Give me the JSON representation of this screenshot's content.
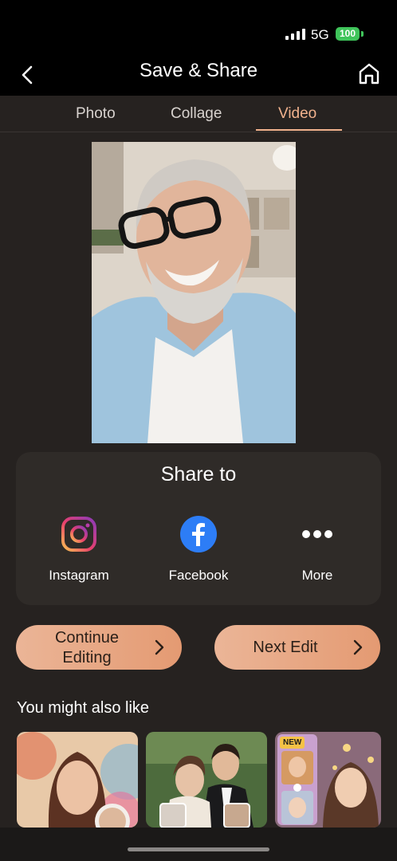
{
  "status_bar": {
    "network": "5G",
    "battery": "100"
  },
  "header": {
    "title": "Save & Share",
    "back_icon": "chevron-left-icon",
    "home_icon": "home-icon"
  },
  "tabs": [
    {
      "label": "Photo",
      "active": false
    },
    {
      "label": "Collage",
      "active": false
    },
    {
      "label": "Video",
      "active": true
    }
  ],
  "share": {
    "title": "Share to",
    "targets": [
      {
        "label": "Instagram",
        "icon": "instagram-icon"
      },
      {
        "label": "Facebook",
        "icon": "facebook-icon"
      },
      {
        "label": "More",
        "icon": "more-dots-icon"
      }
    ]
  },
  "actions": {
    "continue_label": "Continue Editing",
    "next_label": "Next Edit"
  },
  "recommendations": {
    "title": "You might also like",
    "badge": "NEW"
  },
  "colors": {
    "accent": "#f1b28d",
    "button_gradient_start": "#ebb597",
    "button_gradient_end": "#e49a72",
    "background": "#262220"
  }
}
